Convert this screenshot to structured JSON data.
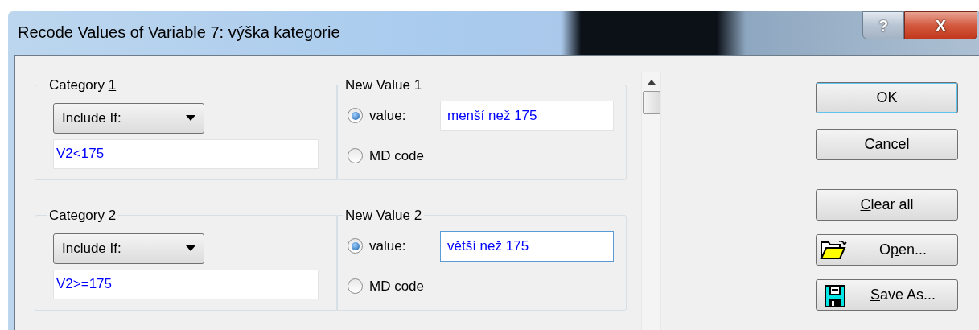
{
  "window": {
    "title": "Recode Values of Variable 7: výška kategorie",
    "help_button": "?",
    "close_button": "X"
  },
  "categories": [
    {
      "label": "Category ",
      "mnemonic": "1",
      "condition": "Include If:",
      "expression": "V2<175",
      "new_value_title": "New Value 1",
      "options": [
        {
          "kind": "text",
          "label": "value:",
          "selected": true,
          "value": "menší než 175",
          "focused": false
        },
        {
          "kind": "plain",
          "label": "MD code",
          "selected": false
        }
      ]
    },
    {
      "label": "Category ",
      "mnemonic": "2",
      "condition": "Include If:",
      "expression": "V2>=175",
      "new_value_title": "New Value 2",
      "options": [
        {
          "kind": "text",
          "label": "value:",
          "selected": true,
          "value": "větší než 175",
          "focused": true
        },
        {
          "kind": "plain",
          "label": "MD code",
          "selected": false
        }
      ]
    }
  ],
  "dialog_buttons": [
    {
      "before": "OK",
      "default": true
    },
    {
      "before": "Cancel",
      "default": false
    }
  ],
  "file_buttons": [
    {
      "kind": "plain",
      "key": "C",
      "after": "lear all"
    },
    {
      "kind": "open",
      "before": "O",
      "key": "p",
      "after": "en..."
    },
    {
      "kind": "save",
      "key": "S",
      "after": "ave As..."
    }
  ]
}
